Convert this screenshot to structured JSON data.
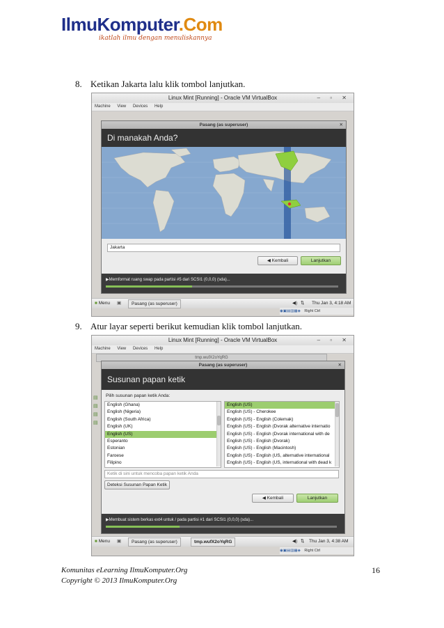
{
  "logo": {
    "brand_part1": "IlmuKomputer",
    "brand_part2": ".Com",
    "tagline": "ikatlah ilmu dengan menuliskannya"
  },
  "steps": [
    {
      "num": "8.",
      "text": "Ketikan Jakarta lalu klik tombol lanjutkan."
    },
    {
      "num": "9.",
      "text": "Atur layar seperti berikut kemudian klik tombol lanjutkan."
    }
  ],
  "vm1": {
    "window_title": "Linux Mint [Running] - Oracle VM VirtualBox",
    "menu": [
      "Machine",
      "View",
      "Devices",
      "Help"
    ],
    "dialog_title": "Pasang (as superuser)",
    "heading": "Di manakah Anda?",
    "location_value": "Jakarta",
    "back_label": "Kembali",
    "next_label": "Lanjutkan",
    "progress_text": "Memformat ruang swap pada partisi #5 dari SCSI1 (0,0,0) (sda)...",
    "progress_fraction": 0.37,
    "taskbar_menu": "Menu",
    "taskbar_item": "Pasang (as superuser)",
    "clock": "Thu Jan  3,  4:18 AM",
    "host_key": "Right Ctrl"
  },
  "vm2": {
    "window_title": "Linux Mint [Running] - Oracle VM VirtualBox",
    "menu": [
      "Machine",
      "View",
      "Devices",
      "Help"
    ],
    "behind_title": "tmp.wufX2oYqRG",
    "dialog_title": "Pasang (as superuser)",
    "heading": "Susunan papan ketik",
    "prompt": "Pilih susunan papan ketik Anda:",
    "layouts": [
      "English (Ghana)",
      "English (Nigeria)",
      "English (South Africa)",
      "English (UK)",
      "English (US)",
      "Esperanto",
      "Estonian",
      "Faroese",
      "Filipino"
    ],
    "layouts_selected": 4,
    "variants": [
      "English (US)",
      "English (US) - Cherokee",
      "English (US) - English (Colemak)",
      "English (US) - English (Dvorak alternative internatio",
      "English (US) - English (Dvorak international with de",
      "English (US) - English (Dvorak)",
      "English (US) - English (Macintosh)",
      "English (US) - English (US, alternative international",
      "English (US) - English (US, international with dead k"
    ],
    "variants_selected": 0,
    "test_placeholder": "Ketik di sini untuk mencoba papan ketik Anda",
    "detect_label": "Deteksi Susunan Papan Ketik",
    "back_label": "Kembali",
    "next_label": "Lanjutkan",
    "progress_text": "Membuat sistem berkas ext4 untuk / pada partisi #1 dari SCSI1 (0,0,0) (sda)...",
    "progress_fraction": 0.32,
    "taskbar_menu": "Menu",
    "taskbar_item1": "Pasang (as superuser)",
    "taskbar_item2": "tmp.wufX2oYqRG",
    "clock": "Thu Jan  3,  4:38 AM",
    "host_key": "Right Ctrl"
  },
  "footer": {
    "line1": "Komunitas eLearning IlmuKomputer.Org",
    "line2": "Copyright © 2013 IlmuKomputer.Org",
    "page": "16"
  }
}
